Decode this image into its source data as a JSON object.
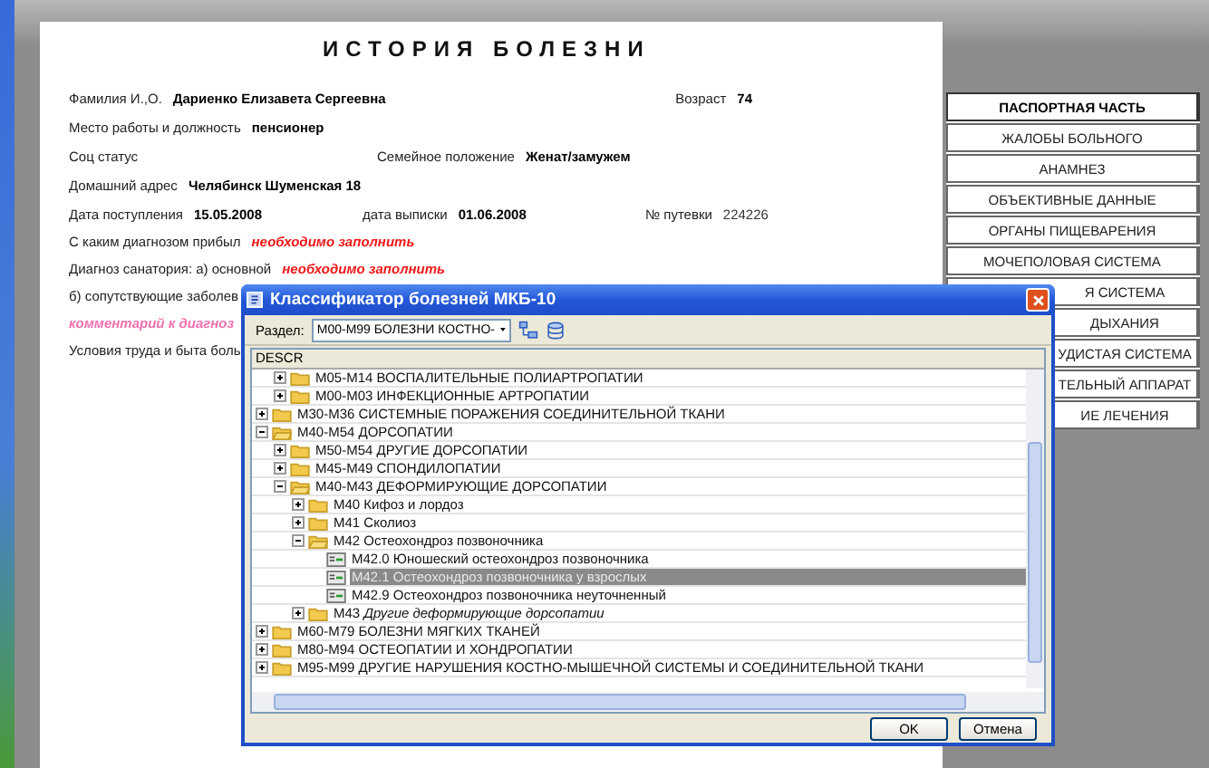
{
  "document": {
    "title": "ИСТОРИЯ БОЛЕЗНИ",
    "rows": [
      {
        "fields": [
          {
            "label": "Фамилия И.,О.",
            "value": "Дариенко  Елизавета  Сергеевна",
            "kind": "value"
          },
          {
            "label": "Возраст",
            "value": "74",
            "kind": "value"
          }
        ]
      },
      {
        "fields": [
          {
            "label": "Место работы и должность",
            "value": "пенсионер",
            "kind": "value"
          }
        ]
      },
      {
        "fields": [
          {
            "label": "Соц статус"
          },
          {
            "label": "Семейное положение",
            "value": "Женат/замужем",
            "kind": "value"
          }
        ]
      },
      {
        "fields": [
          {
            "label": "Домашний адрес",
            "value": "Челябинск Шуменская 18",
            "kind": "value"
          }
        ]
      },
      {
        "fields": [
          {
            "label": "Дата поступления",
            "value": "15.05.2008",
            "kind": "value"
          },
          {
            "label": "дата выписки",
            "value": "01.06.2008",
            "kind": "value"
          },
          {
            "label": "№ путевки",
            "value": "224226",
            "kind": "plain"
          }
        ]
      },
      {
        "fields": [
          {
            "label": "С каким диагнозом прибыл",
            "value": "необходимо заполнить",
            "kind": "required"
          }
        ]
      },
      {
        "fields": [
          {
            "label": "Диагноз санатория: а) основной",
            "value": "необходимо заполнить",
            "kind": "required"
          }
        ]
      },
      {
        "fields": [
          {
            "label": "б) сопутствующие заболев"
          }
        ]
      },
      {
        "fields": [
          {
            "value": "комментарий к диагноз",
            "kind": "comment"
          }
        ]
      },
      {
        "fields": [
          {
            "label": "Условия труда и быта боль"
          }
        ]
      }
    ]
  },
  "tabs": [
    {
      "label": "ПАСПОРТНАЯ ЧАСТЬ",
      "selected": true
    },
    {
      "label": "ЖАЛОБЫ БОЛЬНОГО",
      "selected": false
    },
    {
      "label": "АНАМНЕЗ",
      "selected": false
    },
    {
      "label": "ОБЪЕКТИВНЫЕ ДАННЫЕ",
      "selected": false
    },
    {
      "label": "ОРГАНЫ ПИЩЕВАРЕНИЯ",
      "selected": false
    },
    {
      "label": "МОЧЕПОЛОВАЯ СИСТЕМА",
      "selected": false
    },
    {
      "label": "Я СИСТЕМА",
      "selected": false
    },
    {
      "label": "ДЫХАНИЯ",
      "selected": false
    },
    {
      "label": "УДИСТАЯ СИСТЕМА",
      "selected": false
    },
    {
      "label": "ТЕЛЬНЫЙ АППАРАТ",
      "selected": false
    },
    {
      "label": "ИЕ ЛЕЧЕНИЯ",
      "selected": false
    }
  ],
  "dialog": {
    "title": "Классификатор болезней МКБ-10",
    "section_label": "Раздел:",
    "section_value": "M00-M99 БОЛЕЗНИ КОСТНО-",
    "column": "DESCR",
    "scrolled_branch_children": [
      {
        "label": "M05-M14 ВОСПАЛИТЕЛЬНЫЕ ПОЛИАРТРОПАТИИ",
        "kind": "folder",
        "expanded": false,
        "selected": false
      },
      {
        "label": "M00-M03 ИНФЕКЦИОННЫЕ АРТРОПАТИИ",
        "kind": "folder",
        "expanded": false,
        "selected": false
      }
    ],
    "tree": [
      {
        "label": "M30-M36 СИСТЕМНЫЕ ПОРАЖЕНИЯ СОЕДИНИТЕЛЬНОЙ ТКАНИ",
        "kind": "folder",
        "expanded": false,
        "selected": false
      },
      {
        "label": "M40-M54 ДОРСОПАТИИ",
        "kind": "folder",
        "expanded": true,
        "selected": false,
        "children": [
          {
            "label": "M50-M54 ДРУГИЕ ДОРСОПАТИИ",
            "kind": "folder",
            "expanded": false,
            "selected": false
          },
          {
            "label": "M45-M49 СПОНДИЛОПАТИИ",
            "kind": "folder",
            "expanded": false,
            "selected": false
          },
          {
            "label": "M40-M43 ДЕФОРМИРУЮЩИЕ ДОРСОПАТИИ",
            "kind": "folder",
            "expanded": true,
            "selected": false,
            "children": [
              {
                "label": "M40 Кифоз и лордоз",
                "kind": "folder",
                "expanded": false,
                "selected": false
              },
              {
                "label": "M41 Сколиоз",
                "kind": "folder",
                "expanded": false,
                "selected": false
              },
              {
                "label": "M42 Остеохондроз позвоночника",
                "kind": "folder",
                "expanded": true,
                "selected": false,
                "children": [
                  {
                    "label": "M42.0 Юношеский остеохондроз позвоночника",
                    "kind": "leaf",
                    "selected": false
                  },
                  {
                    "label": "M42.1 Остеохондроз позвоночника у взрослых",
                    "kind": "leaf",
                    "selected": true
                  },
                  {
                    "label": "M42.9 Остеохондроз позвоночника неуточненный",
                    "kind": "leaf",
                    "selected": false
                  }
                ]
              },
              {
                "label": "M43 *Другие деформирующие дорсопатии*",
                "kind": "folder",
                "expanded": false,
                "selected": false
              }
            ]
          }
        ]
      },
      {
        "label": "M60-M79 БОЛЕЗНИ МЯГКИХ ТКАНЕЙ",
        "kind": "folder",
        "expanded": false,
        "selected": false
      },
      {
        "label": "M80-M94 ОСТЕОПАТИИ И ХОНДРОПАТИИ",
        "kind": "folder",
        "expanded": false,
        "selected": false
      },
      {
        "label": "M95-M99 ДРУГИЕ НАРУШЕНИЯ КОСТНО-МЫШЕЧНОЙ СИСТЕМЫ И СОЕДИНИТЕЛЬНОЙ ТКАНИ",
        "kind": "folder",
        "expanded": false,
        "selected": false
      }
    ],
    "buttons": [
      "OK",
      "Отмена"
    ]
  }
}
